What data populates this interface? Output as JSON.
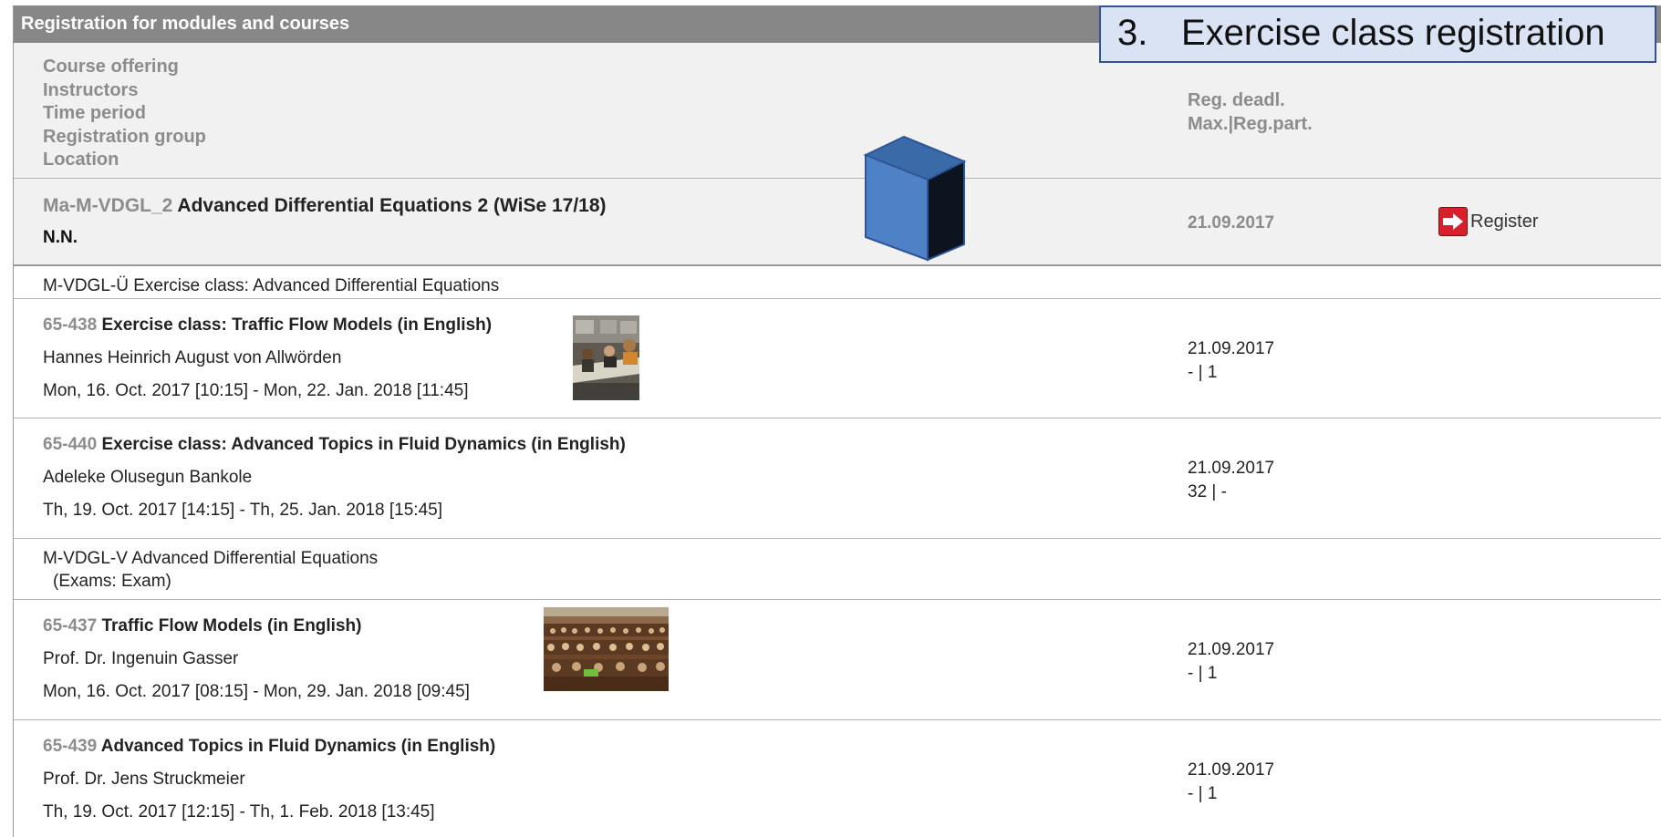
{
  "page": {
    "title": "Registration for modules and courses"
  },
  "callout": {
    "number": "3.",
    "text": "Exercise class registration"
  },
  "header": {
    "left_labels": [
      "Course offering",
      "Instructors",
      "Time period",
      "Registration group",
      "Location"
    ],
    "right_labels": [
      "Reg. deadl.",
      "Max.|Reg.part."
    ]
  },
  "module": {
    "code": "Ma-M-VDGL_2",
    "title": "Advanced Differential Equations 2 (WiSe 17/18)",
    "instructor": "N.N.",
    "deadline": "21.09.2017",
    "register_label": "Register"
  },
  "sections": [
    {
      "line1": "M-VDGL-Ü Exercise class: Advanced Differential Equations",
      "line2": ""
    },
    {
      "line1": "M-VDGL-V Advanced Differential Equations",
      "line2": "(Exams: Exam)"
    }
  ],
  "courses": [
    {
      "code": "65-438",
      "title": "Exercise class: Traffic Flow Models (in English)",
      "instructor": "Hannes Heinrich August von Allwörden",
      "time": "Mon, 16. Oct. 2017 [10:15] - Mon, 22. Jan. 2018 [11:45]",
      "deadline": "21.09.2017",
      "participants": "- | 1"
    },
    {
      "code": "65-440",
      "title": "Exercise class: Advanced Topics in Fluid Dynamics (in English)",
      "instructor": "Adeleke Olusegun Bankole",
      "time": "Th, 19. Oct. 2017 [14:15] - Th, 25. Jan. 2018 [15:45]",
      "deadline": "21.09.2017",
      "participants": "32 | -"
    },
    {
      "code": "65-437",
      "title": "Traffic Flow Models (in English)",
      "instructor": "Prof. Dr. Ingenuin Gasser",
      "time": "Mon, 16. Oct. 2017 [08:15] - Mon, 29. Jan. 2018 [09:45]",
      "deadline": "21.09.2017",
      "participants": "- | 1"
    },
    {
      "code": "65-439",
      "title": "Advanced Topics in Fluid Dynamics (in English)",
      "instructor": "Prof. Dr. Jens Struckmeier",
      "time": "Th, 19. Oct. 2017 [12:15] - Th, 1. Feb. 2018 [13:45]",
      "deadline": "21.09.2017",
      "participants": "- | 1"
    }
  ],
  "colors": {
    "title_bar": "#878787",
    "header_bg": "#f1f1f1",
    "muted_text": "#8c8c8c",
    "callout_bg": "#dae3f3",
    "callout_border": "#2f5597",
    "register_icon": "#d9202a",
    "cube_front": "#4f81c7"
  }
}
